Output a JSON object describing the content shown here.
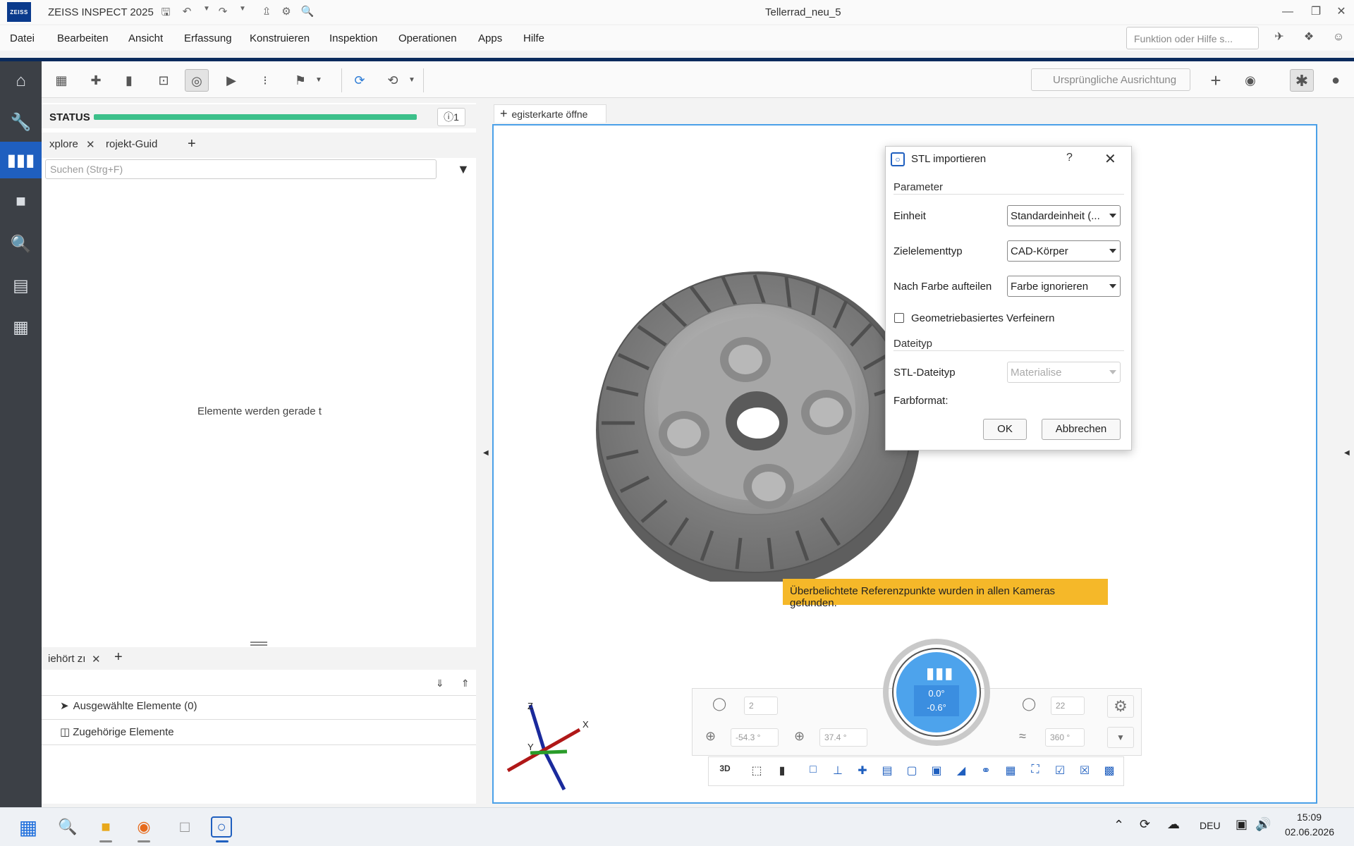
{
  "app": {
    "logo_text": "ZEISS",
    "title": "ZEISS INSPECT 2025",
    "document_title": "Tellerrad_neu_5"
  },
  "menu": [
    "Datei",
    "Bearbeiten",
    "Ansicht",
    "Erfassung",
    "Konstruieren",
    "Inspektion",
    "Operationen",
    "Apps",
    "Hilfe"
  ],
  "search": {
    "placeholder": "Funktion oder Hilfe s..."
  },
  "toolbar": {
    "alignment_label": "Ursprüngliche Ausrichtung"
  },
  "left_panel": {
    "status_label": "STATUS",
    "info_count": "1",
    "tabs": [
      "xplore",
      "rojekt-Guid"
    ],
    "search_placeholder": "Suchen (Strg+F)",
    "loading_text": "Elemente werden gerade t",
    "bottom_tab": "iehört zı",
    "tree_items": [
      "Ausgewählte Elemente (0)",
      "Zugehörige Elemente"
    ]
  },
  "viewport": {
    "tab_label": "egisterkarte öffne",
    "warning": "Überbelichtete Referenzpunkte wurden in allen Kameras gefunden.",
    "nav": {
      "spin_a": "2",
      "spin_b": "-54.3 °",
      "spin_c": "37.4 °",
      "spin_d": "22",
      "spin_e": "360 °",
      "dial_line1": "0.0°",
      "dial_line2": "-0.6°"
    },
    "axes": {
      "x": "X",
      "y": "Y",
      "z": "Z"
    }
  },
  "dialog": {
    "title": "STL importieren",
    "help": "?",
    "section_parameter": "Parameter",
    "einheit_label": "Einheit",
    "einheit_value": "Standardeinheit (...",
    "zielelement_label": "Zielelementtyp",
    "zielelement_value": "CAD-Körper",
    "farbe_label": "Nach Farbe aufteilen",
    "farbe_value": "Farbe ignorieren",
    "checkbox_label": "Geometriebasiertes Verfeinern",
    "checkbox_checked": false,
    "section_dateityp": "Dateityp",
    "stl_label": "STL-Dateityp",
    "stl_value": "Materialise",
    "farbformat_label": "Farbformat:",
    "ok": "OK",
    "cancel": "Abbrechen"
  },
  "taskbar": {
    "lang": "DEU",
    "time": "15:09",
    "date": "02.06.2026"
  },
  "colors": {
    "accent_blue": "#1f5fbf",
    "status_green": "#3cc08a",
    "warning_yellow": "#f5b829",
    "sidebar_dark": "#3c4046"
  }
}
